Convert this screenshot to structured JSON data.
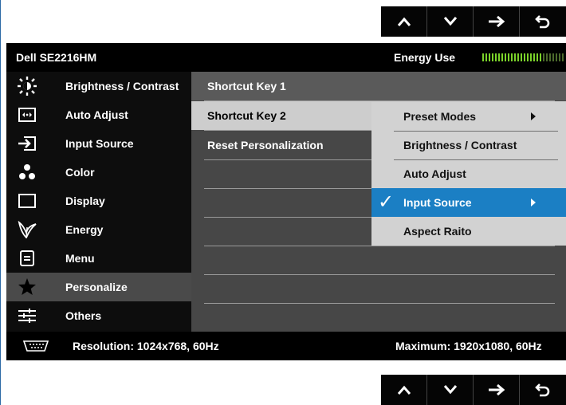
{
  "nav_buttons": [
    {
      "icon": "caret-up-icon",
      "label": "up"
    },
    {
      "icon": "caret-down-icon",
      "label": "down"
    },
    {
      "icon": "arrow-right-icon",
      "label": "select"
    },
    {
      "icon": "return-icon",
      "label": "back"
    }
  ],
  "header": {
    "model": "Dell SE2216HM",
    "energy_label": "Energy Use",
    "energy_level": 0.72
  },
  "menu": {
    "items": [
      {
        "label": "Brightness / Contrast",
        "icon": "brightness-icon"
      },
      {
        "label": "Auto Adjust",
        "icon": "auto-adjust-icon"
      },
      {
        "label": "Input Source",
        "icon": "input-source-icon"
      },
      {
        "label": "Color",
        "icon": "color-icon"
      },
      {
        "label": "Display",
        "icon": "display-icon"
      },
      {
        "label": "Energy",
        "icon": "energy-icon"
      },
      {
        "label": "Menu",
        "icon": "menu-icon"
      },
      {
        "label": "Personalize",
        "icon": "star-icon"
      },
      {
        "label": "Others",
        "icon": "sliders-icon"
      }
    ],
    "selected": "Personalize"
  },
  "submenu": {
    "items": [
      {
        "label": "Shortcut Key 1"
      },
      {
        "label": "Shortcut Key 2"
      },
      {
        "label": "Reset Personalization"
      }
    ],
    "active": "Shortcut Key 2"
  },
  "flyout": {
    "items": [
      {
        "label": "Preset Modes",
        "has_arrow": true
      },
      {
        "label": "Brightness / Contrast",
        "has_arrow": false
      },
      {
        "label": "Auto Adjust",
        "has_arrow": false
      },
      {
        "label": "Input Source",
        "has_arrow": true
      },
      {
        "label": "Aspect Raito",
        "has_arrow": false
      }
    ],
    "selected": "Input Source"
  },
  "footer": {
    "resolution": "Resolution: 1024x768, 60Hz",
    "maximum": "Maximum: 1920x1080, 60Hz",
    "icon": "vga-connector-icon"
  },
  "colors": {
    "accent": "#1b7fc4",
    "meter": "#7bd32a",
    "background": "#0c0c0c"
  }
}
